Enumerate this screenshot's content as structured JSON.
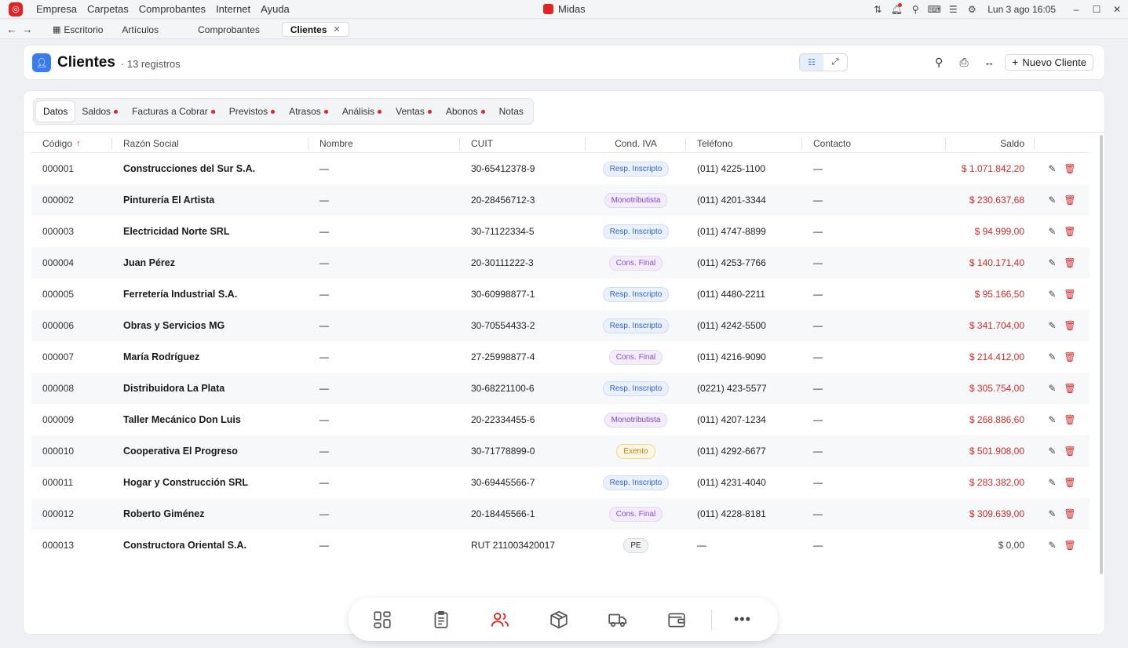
{
  "menubar": {
    "items": [
      "Empresa",
      "Carpetas",
      "Comprobantes",
      "Internet",
      "Ayuda"
    ],
    "app_title": "Midas",
    "clock": "Lun 3 ago  16:05"
  },
  "tabs": {
    "items": [
      {
        "label": "Escritorio",
        "icon": "grid-icon"
      },
      {
        "label": "Artículos"
      },
      {
        "label": "Comprobantes"
      },
      {
        "label": "Clientes",
        "active": true,
        "closable": true
      }
    ]
  },
  "header": {
    "title": "Clientes",
    "count": "· 13 registros",
    "new_button": "Nuevo Cliente"
  },
  "subtabs": [
    {
      "label": "Datos",
      "active": true,
      "dot": false
    },
    {
      "label": "Saldos",
      "dot": true
    },
    {
      "label": "Facturas a Cobrar",
      "dot": true
    },
    {
      "label": "Previstos",
      "dot": true
    },
    {
      "label": "Atrasos",
      "dot": true
    },
    {
      "label": "Análisis",
      "dot": true
    },
    {
      "label": "Ventas",
      "dot": true
    },
    {
      "label": "Abonos",
      "dot": true
    },
    {
      "label": "Notas",
      "dot": false
    }
  ],
  "table": {
    "columns": {
      "codigo": "Código",
      "sort_arrow": "↑",
      "razon": "Razón Social",
      "nombre": "Nombre",
      "cuit": "CUIT",
      "iva": "Cond. IVA",
      "telefono": "Teléfono",
      "contacto": "Contacto",
      "saldo": "Saldo"
    },
    "rows": [
      {
        "codigo": "000001",
        "razon": "Construcciones del Sur S.A.",
        "nombre": "—",
        "cuit": "30-65412378-9",
        "iva": "Resp. Inscripto",
        "iva_type": "ri",
        "telefono": "(011) 4225-1100",
        "contacto": "—",
        "saldo": "$ 1.071.842,20",
        "saldo_type": "red"
      },
      {
        "codigo": "000002",
        "razon": "Pinturería El Artista",
        "nombre": "—",
        "cuit": "20-28456712-3",
        "iva": "Monotributista",
        "iva_type": "mono",
        "telefono": "(011) 4201-3344",
        "contacto": "—",
        "saldo": "$ 230.637,68",
        "saldo_type": "red"
      },
      {
        "codigo": "000003",
        "razon": "Electricidad Norte SRL",
        "nombre": "—",
        "cuit": "30-71122334-5",
        "iva": "Resp. Inscripto",
        "iva_type": "ri",
        "telefono": "(011) 4747-8899",
        "contacto": "—",
        "saldo": "$ 94.999,00",
        "saldo_type": "red"
      },
      {
        "codigo": "000004",
        "razon": "Juan Pérez",
        "nombre": "—",
        "cuit": "20-30111222-3",
        "iva": "Cons. Final",
        "iva_type": "cf",
        "telefono": "(011) 4253-7766",
        "contacto": "—",
        "saldo": "$ 140.171,40",
        "saldo_type": "red"
      },
      {
        "codigo": "000005",
        "razon": "Ferretería Industrial S.A.",
        "nombre": "—",
        "cuit": "30-60998877-1",
        "iva": "Resp. Inscripto",
        "iva_type": "ri",
        "telefono": "(011) 4480-2211",
        "contacto": "—",
        "saldo": "$ 95.166,50",
        "saldo_type": "red"
      },
      {
        "codigo": "000006",
        "razon": "Obras y Servicios MG",
        "nombre": "—",
        "cuit": "30-70554433-2",
        "iva": "Resp. Inscripto",
        "iva_type": "ri",
        "telefono": "(011) 4242-5500",
        "contacto": "—",
        "saldo": "$ 341.704,00",
        "saldo_type": "red"
      },
      {
        "codigo": "000007",
        "razon": "María Rodríguez",
        "nombre": "—",
        "cuit": "27-25998877-4",
        "iva": "Cons. Final",
        "iva_type": "cf",
        "telefono": "(011) 4216-9090",
        "contacto": "—",
        "saldo": "$ 214.412,00",
        "saldo_type": "red"
      },
      {
        "codigo": "000008",
        "razon": "Distribuidora La Plata",
        "nombre": "—",
        "cuit": "30-68221100-6",
        "iva": "Resp. Inscripto",
        "iva_type": "ri",
        "telefono": "(0221) 423-5577",
        "contacto": "—",
        "saldo": "$ 305.754,00",
        "saldo_type": "red"
      },
      {
        "codigo": "000009",
        "razon": "Taller Mecánico Don Luis",
        "nombre": "—",
        "cuit": "20-22334455-6",
        "iva": "Monotributista",
        "iva_type": "mono",
        "telefono": "(011) 4207-1234",
        "contacto": "—",
        "saldo": "$ 268.886,60",
        "saldo_type": "red"
      },
      {
        "codigo": "000010",
        "razon": "Cooperativa El Progreso",
        "nombre": "—",
        "cuit": "30-71778899-0",
        "iva": "Exento",
        "iva_type": "ex",
        "telefono": "(011) 4292-6677",
        "contacto": "—",
        "saldo": "$ 501.908,00",
        "saldo_type": "red"
      },
      {
        "codigo": "000011",
        "razon": "Hogar y Construcción SRL",
        "nombre": "—",
        "cuit": "30-69445566-7",
        "iva": "Resp. Inscripto",
        "iva_type": "ri",
        "telefono": "(011) 4231-4040",
        "contacto": "—",
        "saldo": "$ 283.382,00",
        "saldo_type": "red"
      },
      {
        "codigo": "000012",
        "razon": "Roberto Giménez",
        "nombre": "—",
        "cuit": "20-18445566-1",
        "iva": "Cons. Final",
        "iva_type": "cf",
        "telefono": "(011) 4228-8181",
        "contacto": "—",
        "saldo": "$ 309.639,00",
        "saldo_type": "red"
      },
      {
        "codigo": "000013",
        "razon": "Constructora Oriental S.A.",
        "nombre": "—",
        "cuit": "RUT 211003420017",
        "iva": "PE",
        "iva_type": "pe",
        "telefono": "—",
        "contacto": "—",
        "saldo": "$ 0,00",
        "saldo_type": "zero"
      }
    ]
  },
  "dock": {
    "items": [
      {
        "icon": "dashboard-icon",
        "active": false
      },
      {
        "icon": "clipboard-icon",
        "active": false
      },
      {
        "icon": "users-icon",
        "active": true
      },
      {
        "icon": "box-icon",
        "active": false
      },
      {
        "icon": "truck-icon",
        "active": false
      },
      {
        "icon": "wallet-icon",
        "active": false
      }
    ],
    "more": "•••"
  },
  "colors": {
    "accent_red": "#e02424",
    "saldo_red": "#d12a2a",
    "brand_blue": "#3a7bf0"
  }
}
